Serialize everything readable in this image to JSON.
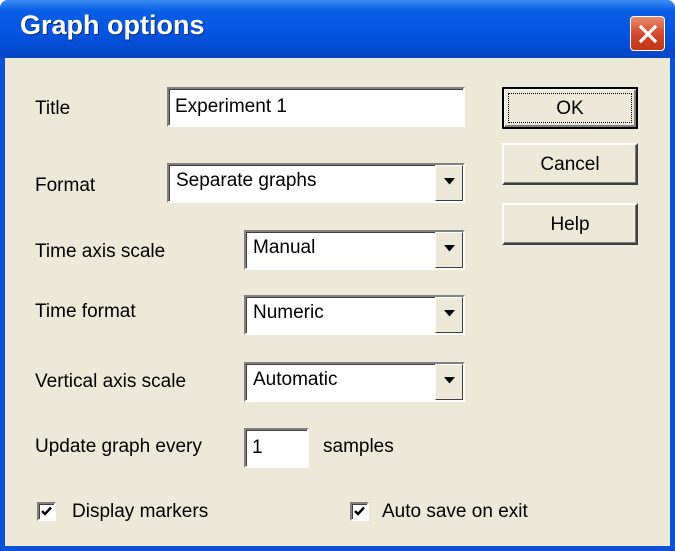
{
  "window": {
    "title": "Graph options"
  },
  "form": {
    "title_label": "Title",
    "title_value": "Experiment 1",
    "format_label": "Format",
    "format_value": "Separate graphs",
    "time_axis_label": "Time axis scale",
    "time_axis_value": "Manual",
    "time_format_label": "Time format",
    "time_format_value": "Numeric",
    "vertical_axis_label": "Vertical axis scale",
    "vertical_axis_value": "Automatic",
    "update_label": "Update graph every",
    "update_value": "1",
    "update_unit": "samples"
  },
  "checkboxes": {
    "display_markers": {
      "label": "Display markers",
      "checked": true
    },
    "auto_save": {
      "label": "Auto save on exit",
      "checked": true
    }
  },
  "buttons": {
    "ok": "OK",
    "cancel": "Cancel",
    "help": "Help"
  },
  "icons": {
    "close": "close-icon",
    "dropdown": "chevron-down-icon",
    "check": "checkmark-icon"
  },
  "colors": {
    "titlebar": "#0553df",
    "close": "#d1452a",
    "dialog_bg": "#ece9d8"
  }
}
